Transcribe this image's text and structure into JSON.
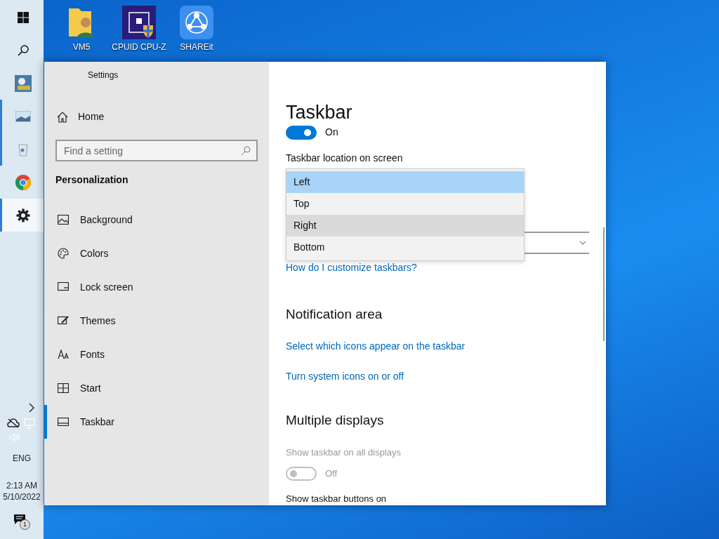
{
  "taskbar": {
    "items": [
      {
        "running": false,
        "selected": false
      },
      {
        "running": false,
        "selected": false
      },
      {
        "running": false,
        "selected": false
      },
      {
        "running": true,
        "selected": false
      },
      {
        "running": true,
        "selected": false
      },
      {
        "running": false,
        "selected": false
      },
      {
        "running": true,
        "selected": true
      }
    ],
    "tray": {
      "language": "ENG",
      "time": "2:13 AM",
      "date": "5/10/2022",
      "notification_count": "1"
    }
  },
  "desktop_icons": [
    {
      "label": "VM5"
    },
    {
      "label": "CPUID CPU-Z"
    },
    {
      "label": "SHAREit"
    }
  ],
  "window": {
    "title": "Settings",
    "sidebar": {
      "home": "Home",
      "search": {
        "placeholder": "Find a setting"
      },
      "section": "Personalization",
      "items": [
        {
          "label": "Background",
          "selected": false
        },
        {
          "label": "Colors",
          "selected": false
        },
        {
          "label": "Lock screen",
          "selected": false
        },
        {
          "label": "Themes",
          "selected": false
        },
        {
          "label": "Fonts",
          "selected": false
        },
        {
          "label": "Start",
          "selected": false
        },
        {
          "label": "Taskbar",
          "selected": true
        }
      ]
    },
    "content": {
      "heading": "Taskbar",
      "toggle": {
        "on": true,
        "label": "On"
      },
      "location": {
        "label": "Taskbar location on screen",
        "options": [
          {
            "label": "Left",
            "selected": true,
            "hovered": false
          },
          {
            "label": "Top",
            "selected": false,
            "hovered": false
          },
          {
            "label": "Right",
            "selected": false,
            "hovered": true
          },
          {
            "label": "Bottom",
            "selected": false,
            "hovered": false
          }
        ]
      },
      "help_link": "How do I customize taskbars?",
      "notification_area": {
        "heading": "Notification area",
        "links": [
          "Select which icons appear on the taskbar",
          "Turn system icons on or off"
        ]
      },
      "multiple_displays": {
        "heading": "Multiple displays",
        "setting": {
          "label": "Show taskbar on all displays",
          "disabled": true,
          "on": false,
          "state_label": "Off"
        },
        "next_label": "Show taskbar buttons on"
      }
    }
  }
}
